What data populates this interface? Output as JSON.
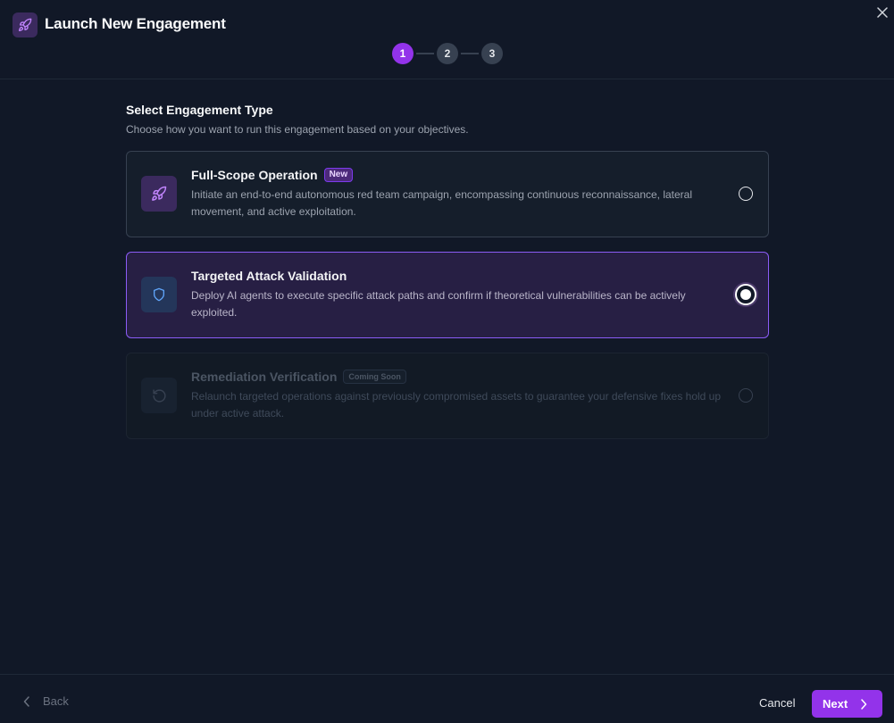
{
  "header": {
    "title": "Launch New Engagement",
    "app_icon": "rocket-icon",
    "close_icon": "close-icon"
  },
  "stepper": {
    "current_step": 1,
    "steps": [
      "1",
      "2",
      "3"
    ]
  },
  "content": {
    "title": "Select Engagement Type",
    "subtitle": "Choose how you want to run this engagement based on your objectives.",
    "options": [
      {
        "title": "Full-Scope Operation",
        "badge": "New",
        "description": "Initiate an end-to-end autonomous red team campaign, encompassing continuous reconnaissance, lateral movement, and active exploitation.",
        "icon": "rocket-icon",
        "selected": false,
        "disabled": false
      },
      {
        "title": "Targeted Attack Validation",
        "badge": "",
        "description": "Deploy AI agents to execute specific attack paths and confirm if theoretical vulnerabilities can be actively exploited.",
        "icon": "shield-icon",
        "selected": true,
        "disabled": false
      },
      {
        "title": "Remediation Verification",
        "badge": "Coming Soon",
        "description": "Relaunch targeted operations against previously compromised assets to guarantee your defensive fixes hold up under active attack.",
        "icon": "rotate-ccw-icon",
        "selected": false,
        "disabled": true
      }
    ]
  },
  "footer": {
    "back_label": "Back",
    "cancel_label": "Cancel",
    "next_label": "Next"
  },
  "colors": {
    "accent": "#9333ea",
    "background": "#111827",
    "selected_card": "#271f44"
  }
}
